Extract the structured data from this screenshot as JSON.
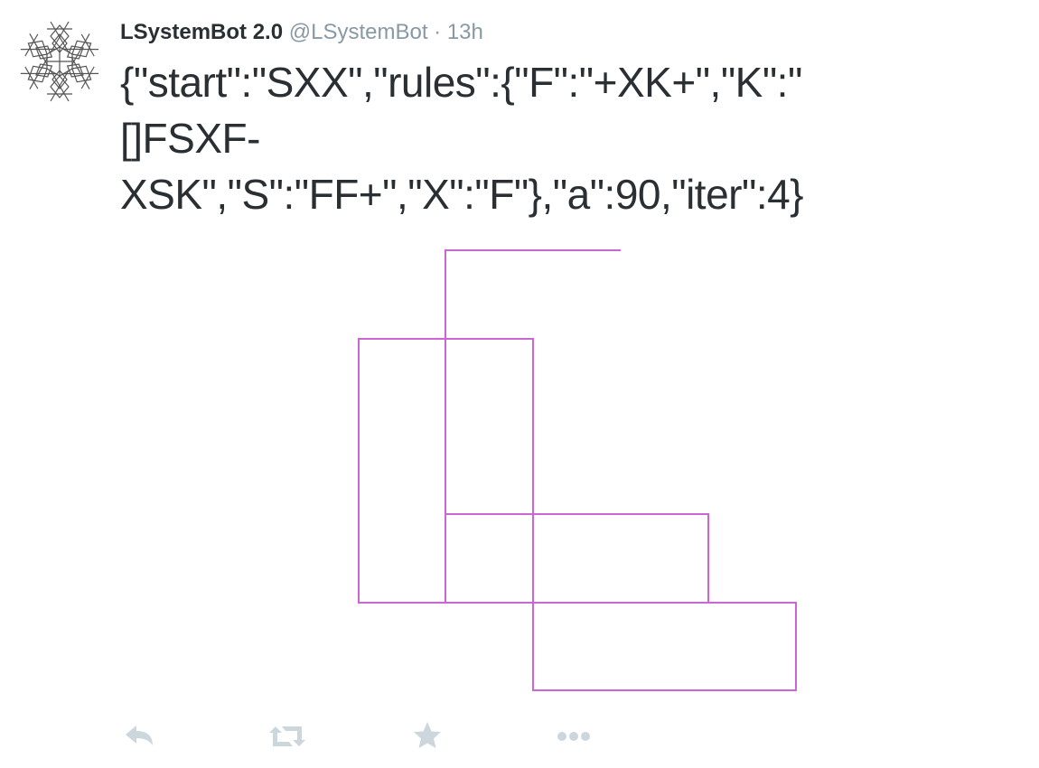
{
  "tweet": {
    "display_name": "LSystemBot 2.0",
    "handle": "@LSystemBot",
    "separator": "·",
    "time": "13h",
    "text_lines": [
      "{\"start\":\"SXX\",\"rules\":{\"F\":\"+XK+\",\"K\":\"",
      "[]FSXF-",
      "XSK\",\"S\":\"FF+\",\"X\":\"F\"},\"a\":90,\"iter\":4}"
    ]
  },
  "media": {
    "stroke_color": "#cc66d6"
  },
  "actions": {
    "icons": [
      "reply-icon",
      "retweet-icon",
      "favorite-icon",
      "more-icon"
    ],
    "icon_color": "#ccd6dd"
  }
}
